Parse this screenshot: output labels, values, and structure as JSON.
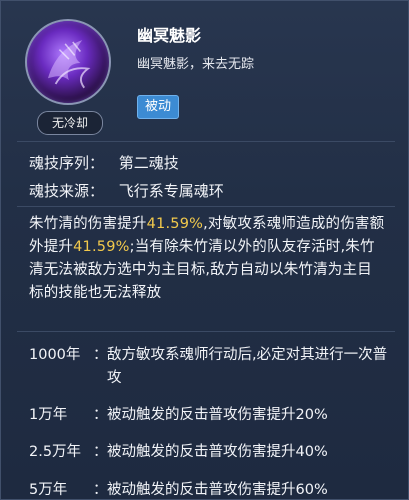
{
  "skill": {
    "name": "幽冥魅影",
    "subtitle": "幽冥魅影，来去无踪",
    "tag": "被动",
    "cooldown": "无冷却",
    "icon": "ghost-claw-icon"
  },
  "info": [
    {
      "key": "魂技序列：",
      "value": "第二魂技"
    },
    {
      "key": "魂技来源：",
      "value": "飞行系专属魂环"
    }
  ],
  "description": {
    "p1": "朱竹清的伤害提升",
    "v1": "41.59%",
    "p2": ",对敏攻系魂师造成的伤害额外提升",
    "v2": "41.59%",
    "p3": ";当有除朱竹清以外的队友存活时,朱竹清无法被敌方选中为主目标,敌方自动以朱竹清为主目标的技能也无法释放"
  },
  "tiers": [
    {
      "level": "1000年",
      "colon": "：",
      "text": "敌方敏攻系魂师行动后,必定对其进行一次普攻"
    },
    {
      "level": "1万年",
      "colon": "：",
      "text": "被动触发的反击普攻伤害提升20%"
    },
    {
      "level": "2.5万年",
      "colon": "：",
      "text": "被动触发的反击普攻伤害提升40%"
    },
    {
      "level": "5万年",
      "colon": "：",
      "text": "被动触发的反击普攻伤害提升60%"
    }
  ],
  "colors": {
    "accent": "#3c8bd3",
    "highlight": "#f2c94c",
    "background": "#222f46"
  }
}
